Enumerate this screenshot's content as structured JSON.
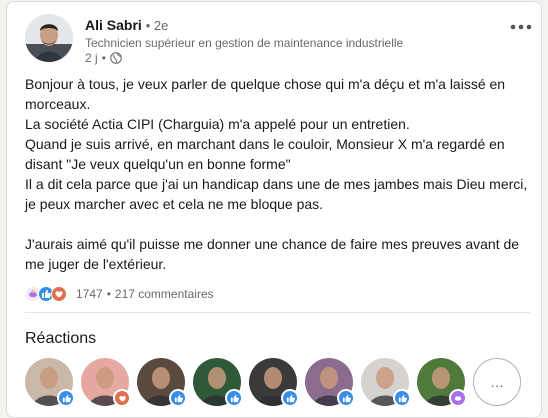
{
  "post": {
    "author": {
      "name": "Ali Sabri",
      "degree": "• 2e",
      "headline": "Technicien supérieur en gestion de maintenance industrielle"
    },
    "time": "2 j",
    "separator": "•",
    "paragraphs": [
      "Bonjour à tous, je veux parler de quelque chose qui m'a déçu et m'a laissé en morceaux.",
      "La société Actia CIPI (Charguia) m'a appelé pour un entretien.",
      "Quand je suis arrivé, en marchant dans le couloir, Monsieur X m'a regardé en disant \"Je veux quelqu'un en bonne forme\"",
      "Il a dit cela parce que j'ai un handicap dans une de mes jambes mais Dieu merci, je peux marcher avec et cela ne me bloque pas.",
      "J'aurais aimé qu'il puisse me donner une chance de faire mes preuves avant de me juger de l'extérieur."
    ],
    "counts": {
      "reactions": "1747",
      "separator": "•",
      "comments": "217 commentaires"
    }
  },
  "reactions_section": {
    "title": "Réactions",
    "more_label": "…",
    "reactors": [
      {
        "badge": "like",
        "face": "#c9b7a8"
      },
      {
        "badge": "love",
        "face": "#e6a9a2"
      },
      {
        "badge": "like",
        "face": "#5b4a3f"
      },
      {
        "badge": "like",
        "face": "#2f5a3a"
      },
      {
        "badge": "like",
        "face": "#3a3a3a"
      },
      {
        "badge": "like",
        "face": "#8b6c8f"
      },
      {
        "badge": "like",
        "face": "#d6d2cf"
      },
      {
        "badge": "support",
        "face": "#4f7a3c"
      }
    ]
  },
  "colors": {
    "like": "#378fe9",
    "love": "#df704d",
    "support": "#a872e8",
    "accent_text": "rgba(0,0,0,0.9)",
    "muted_text": "rgba(0,0,0,0.6)"
  },
  "icons": {
    "more": "ellipsis-icon",
    "visibility": "globe-icon",
    "reaction_like": "thumbs-up-icon",
    "reaction_love": "heart-icon",
    "reaction_support": "support-hand-icon"
  }
}
